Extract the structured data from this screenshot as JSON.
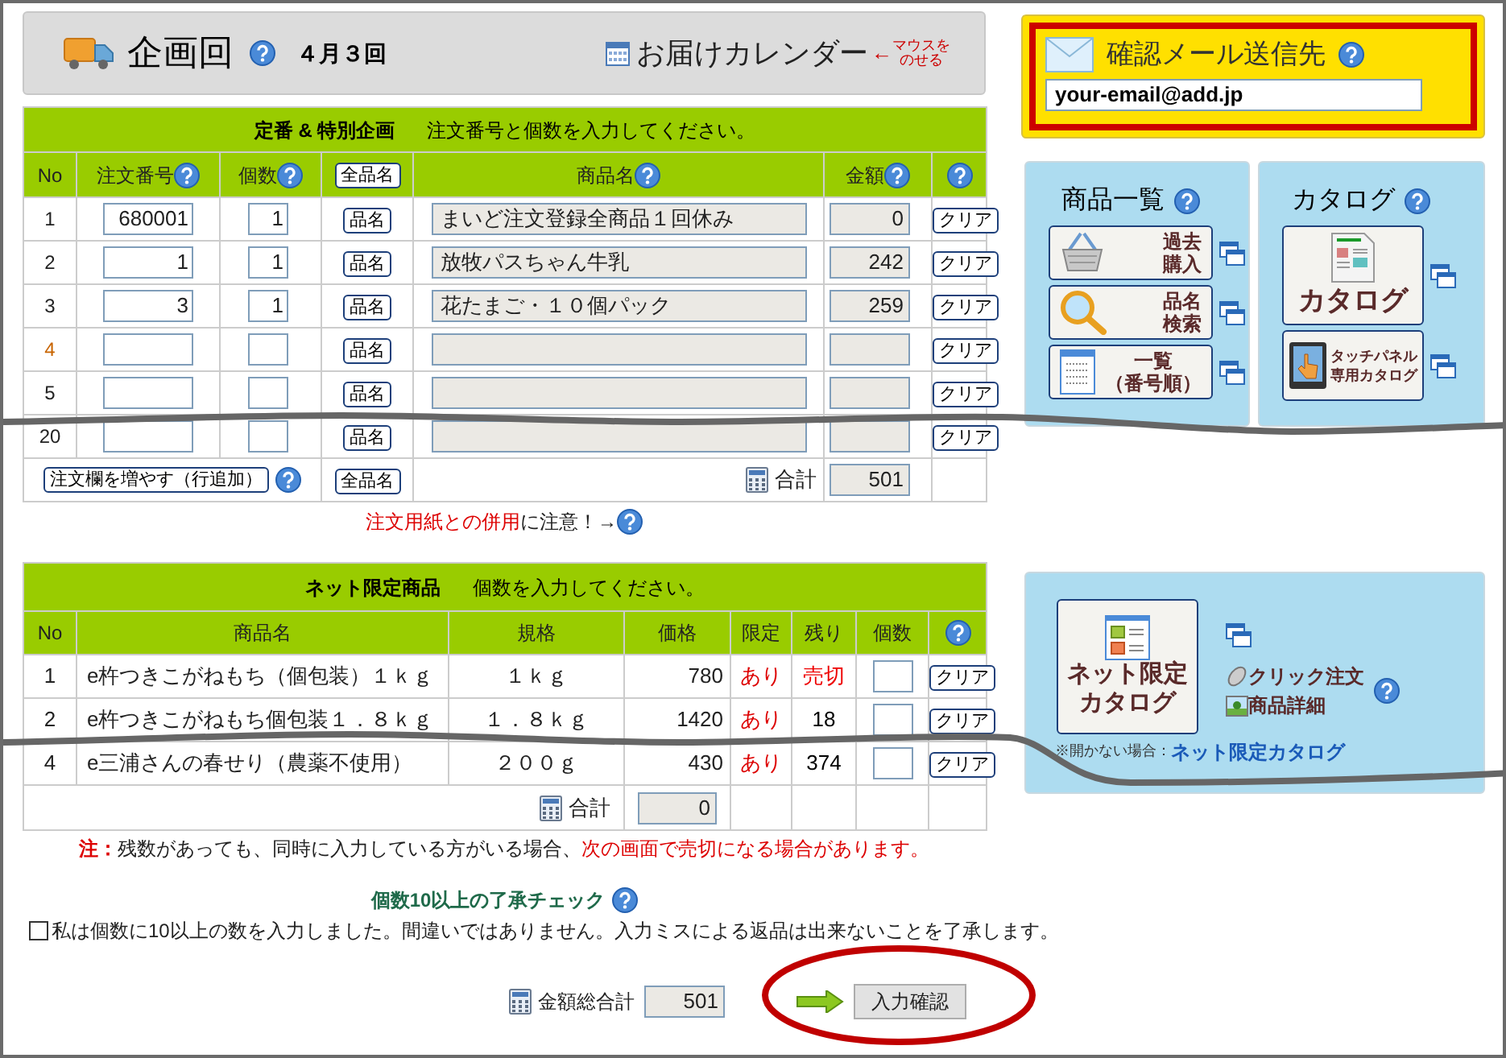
{
  "header": {
    "label": "企画回",
    "round": "４月３回",
    "calendar_link": "お届けカレンダー",
    "hint_arrow": "←",
    "hint_lines": [
      "マウスを",
      "のせる"
    ]
  },
  "order_table": {
    "title": "定番 & 特別企画",
    "instruction": "注文番号と個数を入力してください。",
    "columns": [
      {
        "kind": "text",
        "label": "No",
        "help": false
      },
      {
        "kind": "text",
        "label": "注文番号",
        "help": true
      },
      {
        "kind": "text",
        "label": "個数",
        "help": true
      },
      {
        "kind": "button",
        "label": "全品名"
      },
      {
        "kind": "text",
        "label": "商品名",
        "help": true
      },
      {
        "kind": "text",
        "label": "金額",
        "help": true
      },
      {
        "kind": "help"
      }
    ],
    "rows": [
      {
        "no": "1",
        "order_no": "680001",
        "qty": "1",
        "name_button": "品名",
        "product": "まいど注文登録全商品１回休み",
        "amount": "0",
        "clear": "クリア"
      },
      {
        "no": "2",
        "order_no": "1",
        "qty": "1",
        "name_button": "品名",
        "product": "放牧パスちゃん牛乳",
        "amount": "242",
        "clear": "クリア"
      },
      {
        "no": "3",
        "order_no": "3",
        "qty": "1",
        "name_button": "品名",
        "product": "花たまご・１０個パック",
        "amount": "259",
        "clear": "クリア"
      },
      {
        "no": "4",
        "name_button": "品名",
        "clear": "クリア"
      },
      {
        "no": "5",
        "name_button": "品名",
        "clear": "クリア"
      },
      {
        "no": "20",
        "name_button": "品名",
        "clear": "クリア"
      }
    ],
    "footer": {
      "add_rows_button": "注文欄を増やす（行追加）",
      "all_names_button": "全品名",
      "total_label": "合計",
      "total": "501"
    }
  },
  "order_notice": {
    "warning": "注文用紙との併用",
    "text": "に注意！→"
  },
  "net_table": {
    "title": "ネット限定商品",
    "instruction": "個数を入力してください。",
    "columns": [
      {
        "kind": "text",
        "label": "No"
      },
      {
        "kind": "text",
        "label": "商品名"
      },
      {
        "kind": "text",
        "label": "規格"
      },
      {
        "kind": "text",
        "label": "価格"
      },
      {
        "kind": "text",
        "label": "限定"
      },
      {
        "kind": "text",
        "label": "残り"
      },
      {
        "kind": "text",
        "label": "個数"
      },
      {
        "kind": "help"
      }
    ],
    "rows": [
      {
        "no": "1",
        "product": "e杵つきこがねもち（個包装）１ｋｇ",
        "spec": "１ｋｇ",
        "price": "780",
        "limited": "あり",
        "remaining": "売切",
        "sold_out": true,
        "clear": "クリア"
      },
      {
        "no": "2",
        "product": "e杵つきこがねもち個包装１．８ｋｇ",
        "spec": "１．８ｋｇ",
        "price": "1420",
        "limited": "あり",
        "remaining": "18",
        "sold_out": false,
        "clear": "クリア"
      },
      {
        "no": "4",
        "product": "e三浦さんの春せり（農薬不使用）",
        "spec": "２００ｇ",
        "price": "430",
        "limited": "あり",
        "remaining": "374",
        "sold_out": false,
        "clear": "クリア"
      }
    ],
    "total_label": "合計",
    "total": "0"
  },
  "net_note": {
    "label": "注：",
    "text": "残数があっても、同時に入力している方がいる場合、",
    "warning": "次の画面で売切になる場合があります。"
  },
  "confirm_check": {
    "title": "個数10以上の了承チェック",
    "checked": false,
    "statement": "私は個数に10以上の数を入力しました。間違いではありません。入力ミスによる返品は出来ないことを了承します。"
  },
  "grand_total": {
    "label": "金額総合計",
    "value": "501",
    "submit_button": "入力確認"
  },
  "email_panel": {
    "title": "確認メール送信先",
    "value": "your-email@add.jp"
  },
  "product_list_panel": {
    "title": "商品一覧",
    "buttons": [
      {
        "kind": "basket",
        "lines": [
          "過去",
          "購入"
        ]
      },
      {
        "kind": "search",
        "lines": [
          "品名",
          "検索"
        ]
      },
      {
        "kind": "list",
        "lines": [
          "一覧",
          "（番号順）"
        ]
      }
    ]
  },
  "catalog_panel": {
    "title": "カタログ",
    "buttons": [
      {
        "kind": "catalog",
        "lines": [
          "カタログ"
        ]
      },
      {
        "kind": "tablet",
        "lines": [
          "タッチパネル",
          "専用カタログ"
        ]
      }
    ]
  },
  "net_catalog_panel": {
    "button_lines": [
      "ネット限定",
      "カタログ"
    ],
    "click_order": "クリック注文",
    "product_detail": "商品詳細",
    "fallback_note": "※開かない場合：",
    "fallback_link": "ネット限定カタログ"
  }
}
